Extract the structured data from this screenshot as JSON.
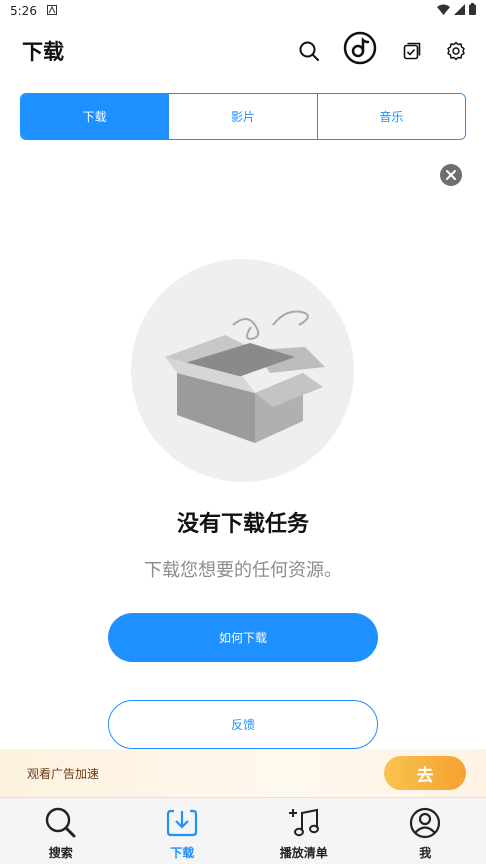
{
  "status_bar": {
    "time": "5:26"
  },
  "header": {
    "title": "下载"
  },
  "tabs": [
    {
      "label": "下载",
      "active": true
    },
    {
      "label": "影片",
      "active": false
    },
    {
      "label": "音乐",
      "active": false
    }
  ],
  "empty_state": {
    "title": "没有下载任务",
    "subtitle": "下载您想要的任何资源。"
  },
  "buttons": {
    "how_to_download": "如何下载",
    "feedback": "反馈"
  },
  "ad_banner": {
    "text": "观看广告加速",
    "button": "去"
  },
  "bottom_nav": [
    {
      "label": "搜索",
      "icon": "search-icon",
      "active": false
    },
    {
      "label": "下载",
      "icon": "download-icon",
      "active": true
    },
    {
      "label": "播放清单",
      "icon": "playlist-icon",
      "active": false
    },
    {
      "label": "我",
      "icon": "profile-icon",
      "active": false
    }
  ],
  "colors": {
    "accent": "#1e90ff",
    "ad_button": "#f6a130",
    "muted_text": "#8c8c8c"
  }
}
